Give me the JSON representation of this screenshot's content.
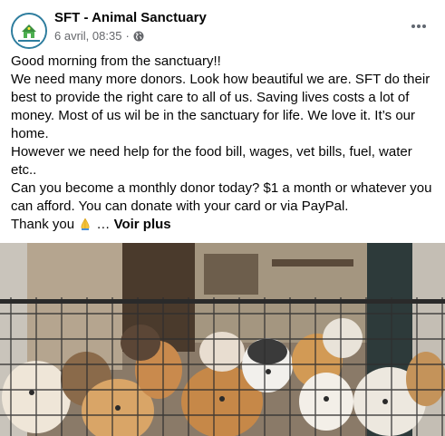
{
  "page": {
    "name": "SFT - Animal Sanctuary",
    "timestamp": "6 avril, 08:35",
    "separator": "·",
    "privacy_icon": "globe-icon",
    "more_icon": "more-options-icon"
  },
  "post": {
    "lines": [
      "Good morning from the sanctuary!!",
      "We need many more donors. Look how beautiful we are. SFT do their",
      "best to provide the right care to all of us. Saving lives costs a lot of",
      "money. Most of us wil be in the sanctuary for life. We love it. It’s our",
      "home.",
      "However we need help for the food bill, wages, vet bills, fuel, water",
      "etc..",
      "Can you become a monthly donor today? $1 a month or whatever you",
      "can afford. You can donate with your card or via PayPal."
    ],
    "last_line_prefix": "Thank you",
    "last_line_emoji": "folded-hands-emoji",
    "ellipsis": "…",
    "see_more_label": "Voir plus"
  },
  "photo": {
    "subject": "dogs-behind-fence-photo"
  },
  "colors": {
    "text": "#050505",
    "meta": "#65676b",
    "avatar_ring": "#2e7d9e"
  }
}
